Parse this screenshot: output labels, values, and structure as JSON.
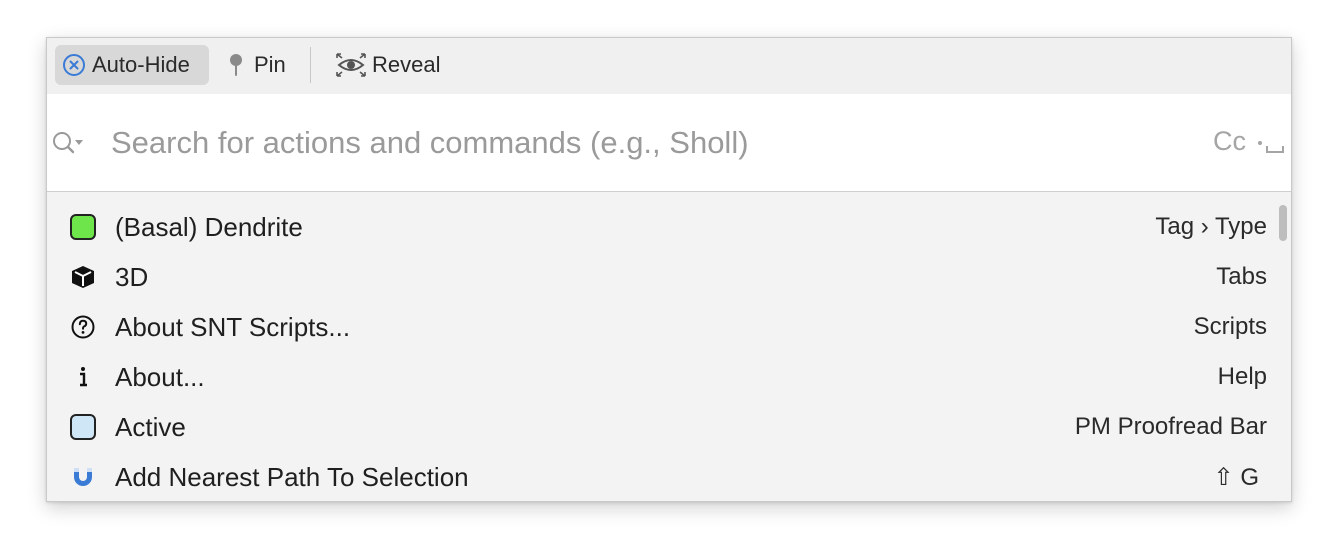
{
  "toolbar": {
    "autohide_label": "Auto-Hide",
    "pin_label": "Pin",
    "reveal_label": "Reveal"
  },
  "search": {
    "placeholder": "Search for actions and commands (e.g., Sholl)",
    "value": "",
    "case_option": "Cc",
    "whitespace_option_icon": "whitespace-icon"
  },
  "colors": {
    "dendrite_swatch": "#6ee54a",
    "active_swatch": "#cfe6f7",
    "magnet_blue": "#3a7bd5"
  },
  "items": [
    {
      "label": "(Basal) Dendrite",
      "right": "Tag › Type",
      "icon": "green-swatch-icon"
    },
    {
      "label": "3D",
      "right": "Tabs",
      "icon": "cube-icon"
    },
    {
      "label": "About SNT Scripts...",
      "right": "Scripts",
      "icon": "question-circle-icon"
    },
    {
      "label": "About...",
      "right": "Help",
      "icon": "info-icon"
    },
    {
      "label": "Active",
      "right": "PM Proofread Bar",
      "icon": "light-blue-swatch-icon"
    },
    {
      "label": "Add Nearest Path To Selection",
      "right": "⇧ G",
      "icon": "magnet-icon"
    }
  ]
}
